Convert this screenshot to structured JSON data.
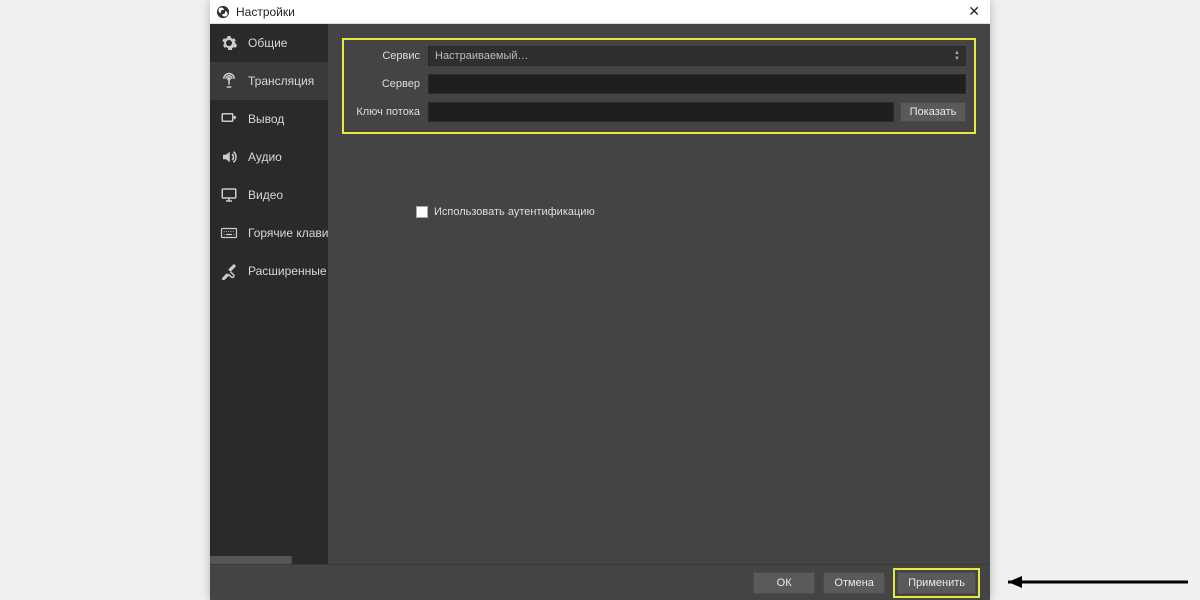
{
  "window": {
    "title": "Настройки"
  },
  "sidebar": {
    "items": [
      {
        "label": "Общие"
      },
      {
        "label": "Трансляция"
      },
      {
        "label": "Вывод"
      },
      {
        "label": "Аудио"
      },
      {
        "label": "Видео"
      },
      {
        "label": "Горячие клавиши"
      },
      {
        "label": "Расширенные"
      }
    ],
    "active_index": 1
  },
  "stream": {
    "service_label": "Сервис",
    "service_value": "Настраиваемый…",
    "server_label": "Сервер",
    "server_value": "",
    "key_label": "Ключ потока",
    "key_value": "",
    "show_button": "Показать",
    "auth_label": "Использовать аутентификацию",
    "auth_checked": false
  },
  "footer": {
    "ok": "ОК",
    "cancel": "Отмена",
    "apply": "Применить"
  },
  "colors": {
    "highlight": "#e7e943"
  }
}
